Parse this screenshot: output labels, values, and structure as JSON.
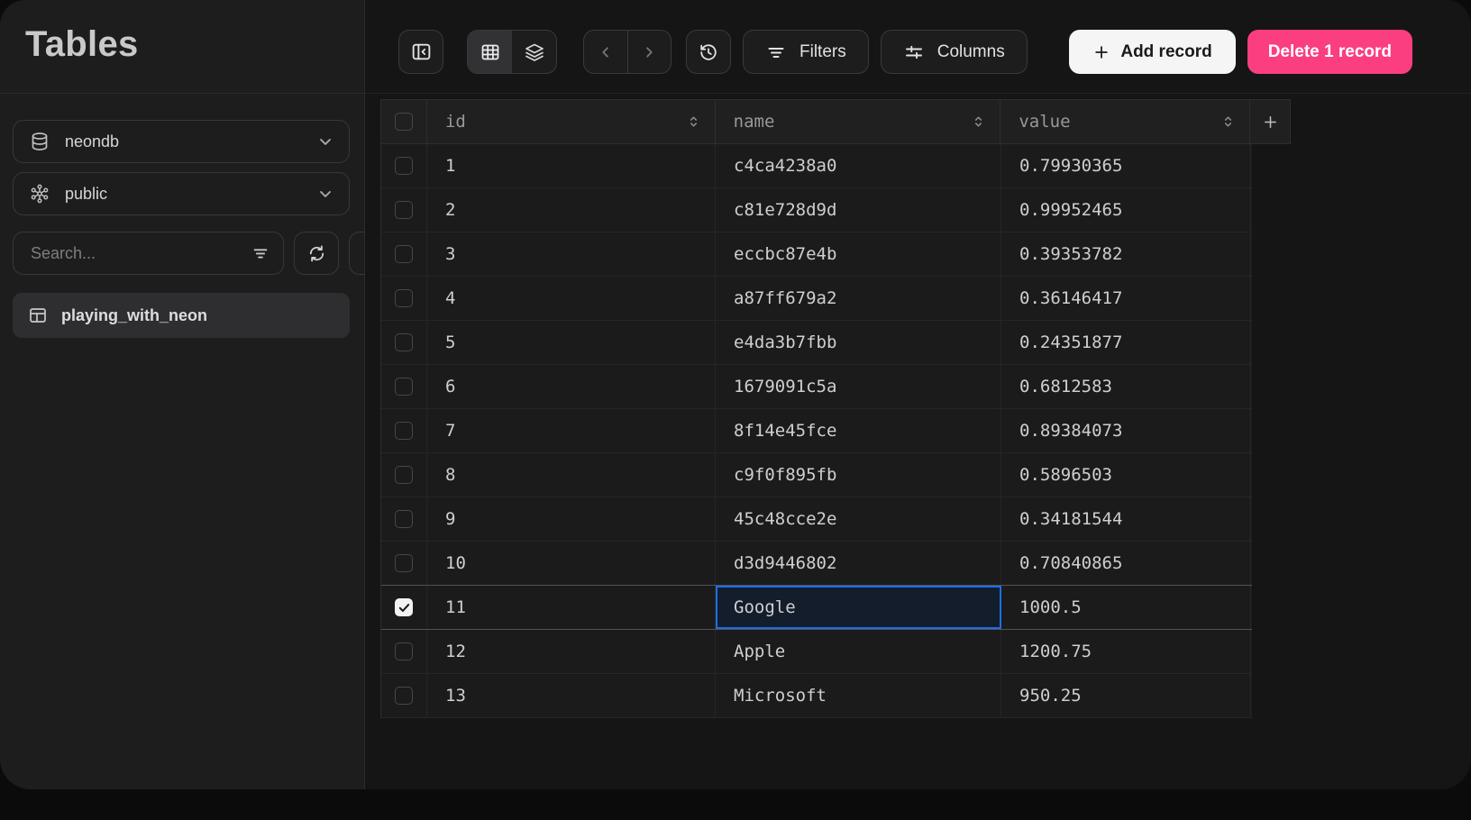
{
  "sidebar": {
    "title": "Tables",
    "database": {
      "label": "neondb"
    },
    "schema": {
      "label": "public"
    },
    "search": {
      "placeholder": "Search..."
    },
    "tables": [
      {
        "label": "playing_with_neon",
        "selected": true
      }
    ]
  },
  "toolbar": {
    "filters_label": "Filters",
    "columns_label": "Columns",
    "add_record_label": "Add record",
    "delete_label": "Delete 1 record"
  },
  "grid": {
    "columns": [
      {
        "key": "id",
        "label": "id"
      },
      {
        "key": "name",
        "label": "name"
      },
      {
        "key": "value",
        "label": "value"
      }
    ],
    "rows": [
      {
        "id": "1",
        "name": "c4ca4238a0",
        "value": "0.79930365",
        "checked": false
      },
      {
        "id": "2",
        "name": "c81e728d9d",
        "value": "0.99952465",
        "checked": false
      },
      {
        "id": "3",
        "name": "eccbc87e4b",
        "value": "0.39353782",
        "checked": false
      },
      {
        "id": "4",
        "name": "a87ff679a2",
        "value": "0.36146417",
        "checked": false
      },
      {
        "id": "5",
        "name": "e4da3b7fbb",
        "value": "0.24351877",
        "checked": false
      },
      {
        "id": "6",
        "name": "1679091c5a",
        "value": "0.6812583",
        "checked": false
      },
      {
        "id": "7",
        "name": "8f14e45fce",
        "value": "0.89384073",
        "checked": false
      },
      {
        "id": "8",
        "name": "c9f0f895fb",
        "value": "0.5896503",
        "checked": false
      },
      {
        "id": "9",
        "name": "45c48cce2e",
        "value": "0.34181544",
        "checked": false
      },
      {
        "id": "10",
        "name": "d3d9446802",
        "value": "0.70840865",
        "checked": false
      },
      {
        "id": "11",
        "name": "Google",
        "value": "1000.5",
        "checked": true,
        "selected_cell": "name"
      },
      {
        "id": "12",
        "name": "Apple",
        "value": "1200.75",
        "checked": false
      },
      {
        "id": "13",
        "name": "Microsoft",
        "value": "950.25",
        "checked": false
      }
    ]
  },
  "colors": {
    "delete_button": "#fb3e80",
    "add_button": "#f5f5f5",
    "selected_cell_border": "#1d6ee8",
    "window_bg": "#1b1b1c",
    "sidebar_bg": "#1d1d1e"
  }
}
